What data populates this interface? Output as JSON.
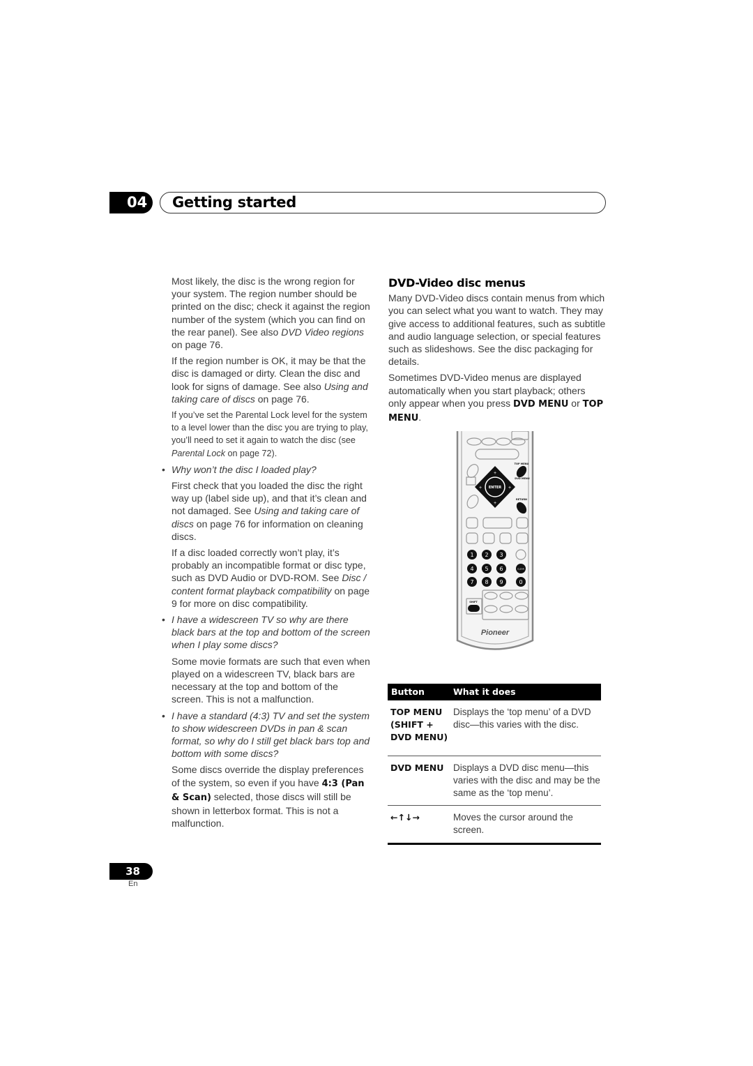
{
  "header": {
    "chapter_number": "04",
    "chapter_title": "Getting started"
  },
  "left_column": {
    "p1_a": "Most likely, the disc is the wrong region for your system. The region number should be printed on the disc; check it against the region number of the system (which you can find on the rear panel). See also ",
    "p1_ref": "DVD Video regions",
    "p1_b": " on page 76.",
    "p2_a": "If the region number is OK, it may be that the disc is damaged or dirty. Clean the disc and look for signs of damage. See also ",
    "p2_ref": "Using and taking care of discs",
    "p2_b": " on page 76.",
    "p3_a": "If you’ve set the Parental Lock level for the system to a level lower than the disc you are trying to play, you’ll need to set it again to watch the disc (see ",
    "p3_ref": "Parental Lock",
    "p3_b": " on page 72).",
    "q1": "Why won’t the disc I loaded play?",
    "a1_p1_a": "First check that you loaded the disc the right way up (label side up), and that it’s clean and not damaged. See ",
    "a1_p1_ref": "Using and taking care of discs",
    "a1_p1_b": " on page 76 for information on cleaning discs.",
    "a1_p2_a": "If a disc loaded correctly won’t play, it’s probably an incompatible format or disc type, such as DVD Audio or DVD-ROM. See ",
    "a1_p2_ref": "Disc / content format playback compatibility",
    "a1_p2_b": " on page 9 for more on disc compatibility.",
    "q2": "I have a widescreen TV so why are there black bars at the top and bottom of the screen when I play some discs?",
    "a2": "Some movie formats are such that even when played on a widescreen TV, black bars are necessary at the top and bottom of the screen. This is not a malfunction.",
    "q3": "I have a standard (4:3) TV and set the system to show widescreen DVDs in pan & scan format, so why do I still get black bars top and bottom with some discs?",
    "a3_a": "Some discs override the display preferences of the system, so even if you have ",
    "a3_bold": "4:3 (Pan & Scan)",
    "a3_b": " selected, those discs will still be shown in letterbox format. This is not a malfunction."
  },
  "right_column": {
    "heading": "DVD-Video disc menus",
    "p1": "Many DVD-Video discs contain menus from which you can select what you want to watch. They may give access to additional features, such as subtitle and audio language selection, or special features such as slideshows. See the disc packaging for details.",
    "p2_a": "Sometimes DVD-Video menus are displayed automatically when you start playback; others only appear when you press ",
    "p2_bold1": "DVD MENU",
    "p2_mid": " or ",
    "p2_bold2": "TOP MENU",
    "p2_end": "."
  },
  "remote": {
    "brand": "Pioneer",
    "enter_label": "ENTER",
    "top_menu_label": "TOP MENU",
    "dvd_menu_label": "DVD MENU",
    "return_label": "RETURN",
    "shift_label": "SHIFT",
    "clear_label": "CLEAR",
    "number_keys": [
      "1",
      "2",
      "3",
      "4",
      "5",
      "6",
      "7",
      "8",
      "9",
      "0"
    ]
  },
  "table": {
    "headers": [
      "Button",
      "What it does"
    ],
    "rows": [
      {
        "button": "TOP MENU (SHIFT + DVD MENU)",
        "description": "Displays the ‘top menu’ of a DVD disc—this varies with the disc."
      },
      {
        "button": "DVD MENU",
        "description": "Displays a DVD disc menu—this varies with the disc and may be the same as the ‘top menu’."
      },
      {
        "button": "←↑↓→",
        "description": "Moves the cursor around the screen."
      }
    ]
  },
  "footer": {
    "page_number": "38",
    "language": "En"
  }
}
